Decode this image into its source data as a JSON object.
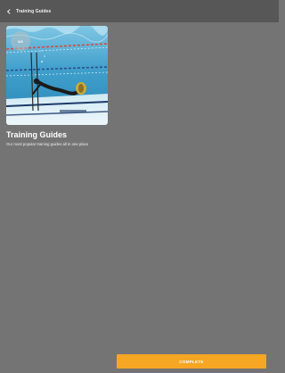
{
  "header": {
    "back_icon": "chevron-left-icon",
    "title": "Training Guides"
  },
  "card": {
    "badge": "6/3",
    "image_subject": "diver swimming underwater in a pool"
  },
  "section": {
    "title": "Training Guides",
    "subtitle": "Our most popular training guides all in one place"
  },
  "footer": {
    "complete_label": "COMPLETE"
  },
  "colors": {
    "background": "#747474",
    "topbar": "#575757",
    "accent": "#f5a623",
    "water": "#4aa9d2"
  }
}
